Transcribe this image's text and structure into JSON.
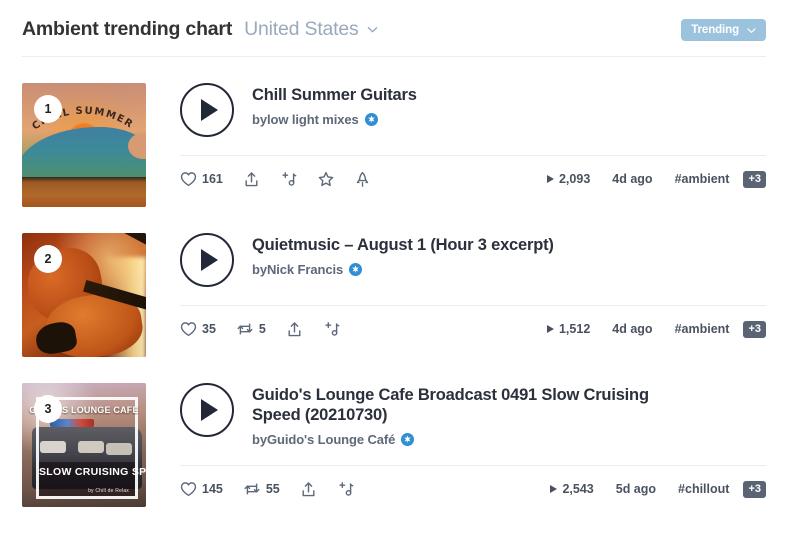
{
  "header": {
    "title": "Ambient trending chart",
    "region": "United States",
    "region_caret_icon": "chevron-down-icon",
    "filter_label": "Trending",
    "filter_caret_icon": "chevron-down-icon",
    "filter_color": "#9cc3de"
  },
  "tracks": [
    {
      "rank": "1",
      "title": "Chill Summer Guitars",
      "by_prefix": "by ",
      "artist": "low light mixes",
      "verified": true,
      "artwork_alt": "Chill Summer Guitars artwork – sunset wave illustration",
      "artwork_text": "CHILL SUMMER GUITARS",
      "likes": "161",
      "reposts": null,
      "plays": "2,093",
      "age": "4d ago",
      "tag": "#ambient",
      "tag_more": "+3",
      "actions": [
        "heart-icon",
        "share-icon",
        "add-to-playlist-icon",
        "star-icon",
        "promote-icon"
      ]
    },
    {
      "rank": "2",
      "title": "Quietmusic – August 1 (Hour 3 excerpt)",
      "by_prefix": "by ",
      "artist": "Nick Francis",
      "verified": true,
      "artwork_alt": "Quietmusic artwork – violins photo",
      "artwork_text": "",
      "likes": "35",
      "reposts": "5",
      "plays": "1,512",
      "age": "4d ago",
      "tag": "#ambient",
      "tag_more": "+3",
      "actions": [
        "heart-icon",
        "repost-icon",
        "share-icon",
        "add-to-playlist-icon"
      ]
    },
    {
      "rank": "3",
      "title": "Guido's Lounge Cafe Broadcast 0491 Slow Cruising Speed (20210730)",
      "by_prefix": "by ",
      "artist": "Guido's Lounge Café",
      "verified": true,
      "artwork_alt": "Guido's Lounge Cafe artwork – classic car at night",
      "artwork_text_top": "GUIDO'S LOUNGE CAFE",
      "artwork_text_bottom": "SLOW CRUISING SPEED",
      "artwork_text_sub": "by Chill de Relax",
      "likes": "145",
      "reposts": "55",
      "plays": "2,543",
      "age": "5d ago",
      "tag": "#chillout",
      "tag_more": "+3",
      "actions": [
        "heart-icon",
        "repost-icon",
        "share-icon",
        "add-to-playlist-icon"
      ]
    }
  ]
}
